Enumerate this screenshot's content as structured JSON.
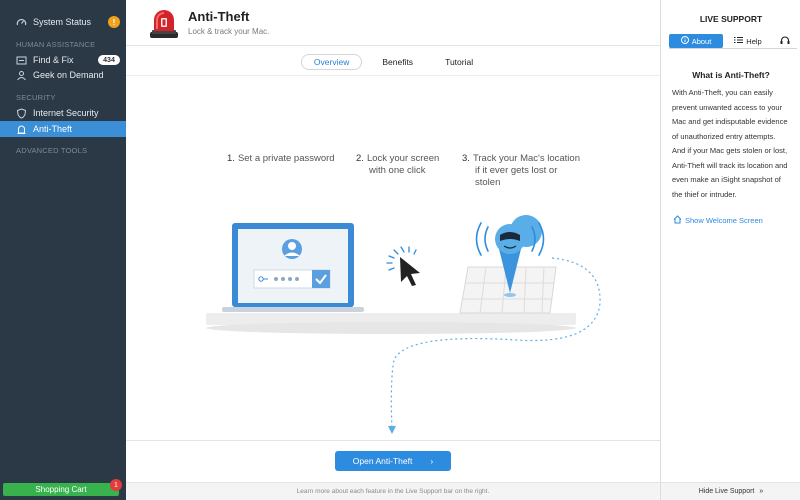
{
  "sidebar": {
    "system_status": "System Status",
    "section_human": "HUMAN ASSISTANCE",
    "find_fix": "Find & Fix",
    "find_fix_count": "434",
    "geek_on_demand": "Geek on Demand",
    "section_security": "SECURITY",
    "internet_security": "Internet Security",
    "anti_theft": "Anti-Theft",
    "section_advanced": "ADVANCED TOOLS",
    "warning_glyph": "!",
    "cart_label": "Shopping Cart",
    "cart_count": "1"
  },
  "header": {
    "title": "Anti-Theft",
    "subtitle": "Lock & track your Mac."
  },
  "tabs": [
    {
      "label": "Overview",
      "active": true
    },
    {
      "label": "Benefits",
      "active": false
    },
    {
      "label": "Tutorial",
      "active": false
    }
  ],
  "steps": [
    {
      "num": "1.",
      "text": "Set a private password"
    },
    {
      "num": "2.",
      "text": "Lock your screen",
      "text2": "with one click"
    },
    {
      "num": "3.",
      "text": "Track your Mac's location",
      "text2": "if it ever gets lost or",
      "text3": "stolen"
    }
  ],
  "primary_button": {
    "label": "Open Anti-Theft",
    "arrow": "›"
  },
  "footer_text": "Learn more about each feature in the Live Support bar on the right.",
  "live_support": {
    "title": "LIVE SUPPORT",
    "tab_about": "About",
    "tab_help": "Help",
    "heading": "What is Anti-Theft?",
    "body_lines": [
      "With Anti-Theft, you can easily",
      "prevent unwanted access to your",
      "Mac and get indisputable evidence",
      "of unauthorized entry attempts.",
      "And if your Mac gets stolen or lost,",
      "Anti-Theft will track its location and",
      "even make an iSight snapshot of",
      "the thief or intruder."
    ],
    "welcome_link": "Show Welcome Screen",
    "hide_label": "Hide Live Support",
    "hide_icon": "»"
  },
  "colors": {
    "accent": "#2d8be0",
    "sidebar_bg": "#2b3845",
    "active_item": "#3a8fd6",
    "cart_green": "#37b24d",
    "badge_red": "#e23c3c",
    "warning": "#f0a21c"
  }
}
